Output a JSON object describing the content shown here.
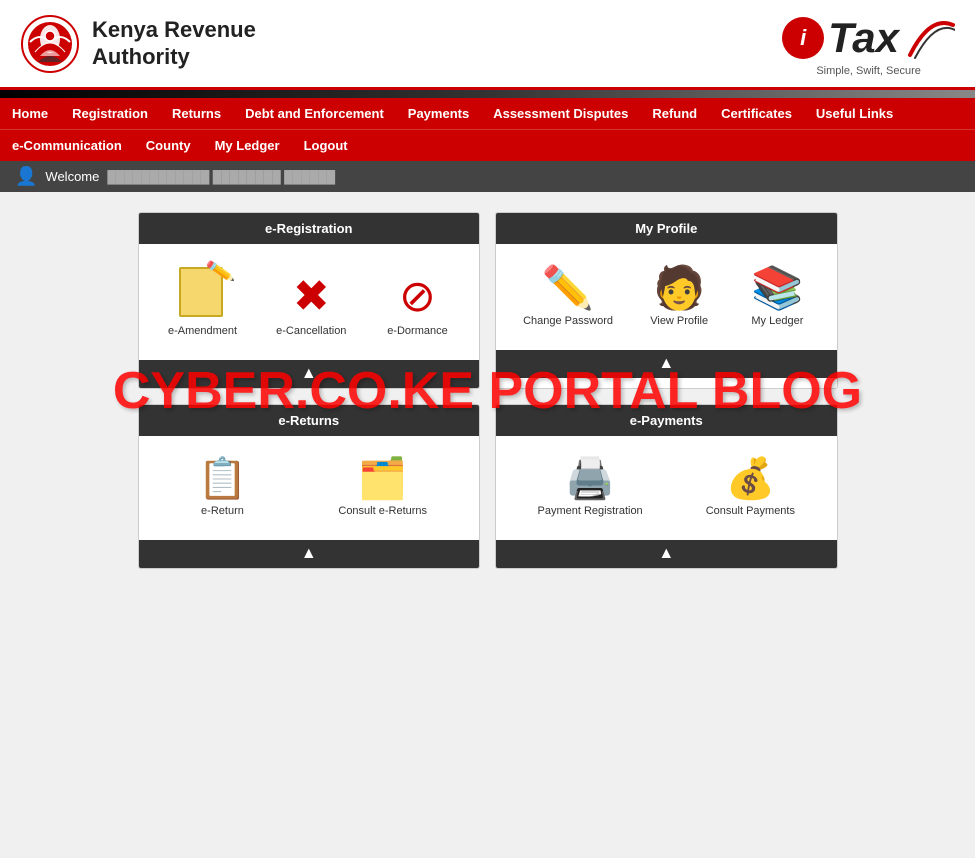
{
  "header": {
    "kra_name_line1": "Kenya Revenue",
    "kra_name_line2": "Authority",
    "itax_letter_i": "i",
    "itax_letter_tax": "Tax",
    "itax_tagline": "Simple, Swift, Secure"
  },
  "navbar": {
    "row1": [
      {
        "label": "Home",
        "id": "home"
      },
      {
        "label": "Registration",
        "id": "registration"
      },
      {
        "label": "Returns",
        "id": "returns"
      },
      {
        "label": "Debt and Enforcement",
        "id": "debt"
      },
      {
        "label": "Payments",
        "id": "payments"
      },
      {
        "label": "Assessment Disputes",
        "id": "assessment"
      },
      {
        "label": "Refund",
        "id": "refund"
      },
      {
        "label": "Certificates",
        "id": "certificates"
      },
      {
        "label": "Useful Links",
        "id": "useful-links"
      }
    ],
    "row2": [
      {
        "label": "e-Communication",
        "id": "e-communication"
      },
      {
        "label": "County",
        "id": "county"
      },
      {
        "label": "My Ledger",
        "id": "my-ledger"
      },
      {
        "label": "Logout",
        "id": "logout"
      }
    ]
  },
  "welcome_bar": {
    "text": "Welcome",
    "user_name": ""
  },
  "panels": {
    "e_registration": {
      "title": "e-Registration",
      "items": [
        {
          "id": "e-amendment",
          "label": "e-Amendment",
          "icon": "📄"
        },
        {
          "id": "e-cancellation",
          "label": "e-Cancellation",
          "icon": "❌"
        },
        {
          "id": "e-dormance",
          "label": "e-Dormance",
          "icon": "🚫"
        }
      ],
      "footer": "▲"
    },
    "my_profile": {
      "title": "My Profile",
      "items": [
        {
          "id": "change-password",
          "label": "Change Password",
          "icon": "✏️"
        },
        {
          "id": "view-profile",
          "label": "View Profile",
          "icon": "👤"
        },
        {
          "id": "my-ledger",
          "label": "My Ledger",
          "icon": "📚"
        }
      ],
      "footer": "▲"
    },
    "e_returns": {
      "title": "e-Returns",
      "items": [
        {
          "id": "e-return",
          "label": "e-Return",
          "icon": "📋"
        },
        {
          "id": "consult-e-returns",
          "label": "Consult e-Returns",
          "icon": "🗂️"
        }
      ],
      "footer": "▲"
    },
    "e_payments": {
      "title": "e-Payments",
      "items": [
        {
          "id": "payment-registration",
          "label": "Payment Registration",
          "icon": "💳"
        },
        {
          "id": "consult-payments",
          "label": "Consult Payments",
          "icon": "💰"
        }
      ],
      "footer": "▲"
    }
  },
  "watermark": {
    "text": "CYBER.CO.KE PORTAL BLOG"
  }
}
